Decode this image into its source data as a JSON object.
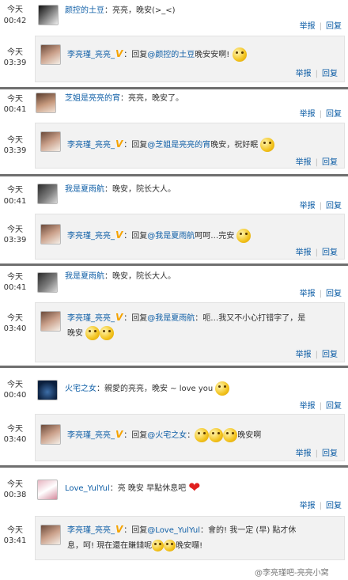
{
  "actions": {
    "report": "举报",
    "sep": "|",
    "reply": "回复"
  },
  "reply_prefix": "：回复",
  "me": {
    "name": "李亮瑾_亮亮_",
    "badge": "V"
  },
  "threads": [
    {
      "comment": {
        "date": "今天",
        "time": "00:42",
        "user": "颜控的土豆",
        "text": "：亮亮，晚安(>_<)"
      },
      "reply": {
        "date": "今天",
        "time": "03:39",
        "mention": "@颜控的土豆",
        "text": "晚安安啊!"
      }
    },
    {
      "comment": {
        "date": "今天",
        "time": "00:41",
        "user": "芝姐是亮亮的宵",
        "text": "：亮亮，晚安了。"
      },
      "reply": {
        "date": "今天",
        "time": "03:39",
        "mention": "@芝姐是亮亮的宵",
        "text": "晚安，祝好眠"
      }
    },
    {
      "comment": {
        "date": "今天",
        "time": "00:41",
        "user": "我是夏雨航",
        "text": "：晚安，院长大人。"
      },
      "reply": {
        "date": "今天",
        "time": "03:39",
        "mention": "@我是夏雨航",
        "text": "呵呵…完安"
      }
    },
    {
      "comment": {
        "date": "今天",
        "time": "00:41",
        "user": "我是夏雨航",
        "text": "：晚安，院长大人。"
      },
      "reply": {
        "date": "今天",
        "time": "03:40",
        "mention": "@我是夏雨航",
        "text": "：呃…我又不小心打错字了，是",
        "text2": "晚安"
      }
    },
    {
      "comment": {
        "date": "今天",
        "time": "00:40",
        "user": "火宅之女",
        "text": "：親愛的亮亮，晚安 ~ love you"
      },
      "reply": {
        "date": "今天",
        "time": "03:40",
        "mention": "@火宅之女",
        "text": "：",
        "text_after": "晚安啊"
      }
    },
    {
      "comment": {
        "date": "今天",
        "time": "00:38",
        "user": "Love_YulYul",
        "text": "：亮 晚安 早點休息吧"
      },
      "reply": {
        "date": "今天",
        "time": "03:41",
        "mention": "@Love_YulYul",
        "text": "：會的! 我一定 (早) 點才休",
        "text2": "息，呵! 現在還在賺錢呢",
        "text2_after": "晚安囉!"
      }
    }
  ],
  "watermark": "@李亮瑾吧-亮亮小窝"
}
